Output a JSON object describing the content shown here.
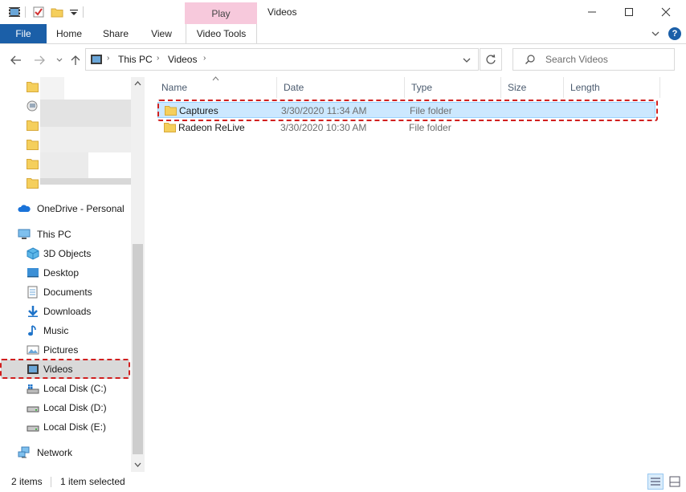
{
  "window": {
    "title": "Videos",
    "context_tab": "Play",
    "controls": [
      "minimize-icon",
      "maximize-icon",
      "close-icon"
    ]
  },
  "ribbon": {
    "tabs": [
      "File",
      "Home",
      "Share",
      "View",
      "Video Tools"
    ],
    "help": "?"
  },
  "address": {
    "crumbs": [
      "This PC",
      "Videos"
    ]
  },
  "search": {
    "placeholder": "Search Videos"
  },
  "navpane": {
    "onedrive": "OneDrive - Personal",
    "this_pc": "This PC",
    "items": [
      "3D Objects",
      "Desktop",
      "Documents",
      "Downloads",
      "Music",
      "Pictures",
      "Videos",
      "Local Disk (C:)",
      "Local Disk (D:)",
      "Local Disk (E:)"
    ],
    "network": "Network",
    "selected": "Videos"
  },
  "columns": [
    "Name",
    "Date",
    "Type",
    "Size",
    "Length"
  ],
  "rows": [
    {
      "name": "Captures",
      "date": "3/30/2020 11:34 AM",
      "type": "File folder",
      "selected": true
    },
    {
      "name": "Radeon ReLive",
      "date": "3/30/2020 10:30 AM",
      "type": "File folder",
      "selected": false
    }
  ],
  "status": {
    "count": "2 items",
    "selected": "1 item selected"
  },
  "colors": {
    "file_tab": "#1b5fa8",
    "context_tab": "#f7c9dc",
    "selection": "#cce8ff",
    "highlight": "#d01f1f",
    "folder": "#f5cf5c"
  }
}
